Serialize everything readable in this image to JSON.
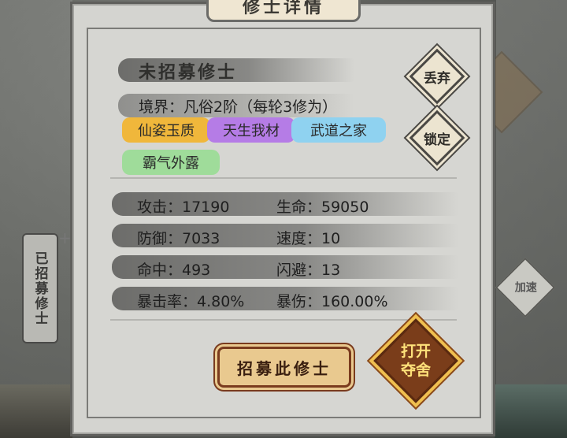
{
  "background": {
    "side_label": "已招募修士",
    "right_button": "加速"
  },
  "dialog": {
    "title": "修士详情",
    "name": "未招募修士",
    "realm": "境界：凡俗2阶（每轮3修为）",
    "tags": [
      {
        "label": "仙姿玉质",
        "color": "#f0b73b"
      },
      {
        "label": "天生我材",
        "color": "#b57ce6"
      },
      {
        "label": "武道之家",
        "color": "#8fd2f0"
      },
      {
        "label": "霸气外露",
        "color": "#9fdc9a"
      }
    ],
    "discard_button": "丢弃",
    "lock_button": "锁定",
    "stats": {
      "attack": "攻击：17190",
      "hp": "生命：59050",
      "defense": "防御：7033",
      "speed": "速度：10",
      "hit": "命中：493",
      "dodge": "闪避：13",
      "crit_rate": "暴击率：4.80%",
      "crit_damage": "暴伤：160.00%"
    },
    "recruit_button": "招募此修士",
    "open_button": "打开夺舍"
  }
}
